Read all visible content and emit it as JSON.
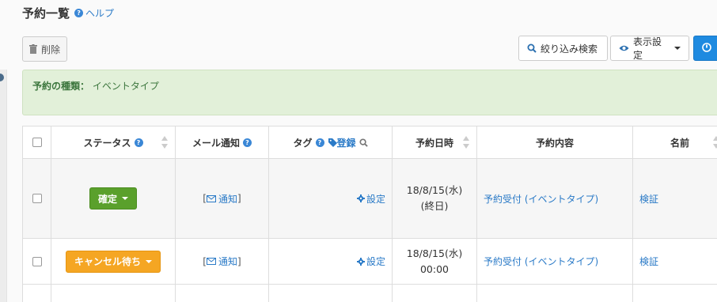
{
  "page": {
    "title": "予約一覧",
    "help_label": "ヘルプ",
    "help_icon_glyph": "?"
  },
  "toolbar": {
    "delete_label": "削除",
    "filter_label": "絞り込み検索",
    "display_label": "表示設定"
  },
  "info": {
    "label": "予約の種類：",
    "value": "イベントタイプ"
  },
  "table": {
    "headers": {
      "status": "ステータス",
      "mail": "メール通知",
      "tag": "タグ",
      "tag_register": "登録",
      "datetime": "予約日時",
      "content": "予約内容",
      "name": "名前"
    },
    "rows": [
      {
        "status": "確定",
        "status_color": "#5aa02c",
        "notify_open": "[",
        "notify_label": "通知",
        "notify_close": "]",
        "settings_label": "設定",
        "date_line1": "18/8/15(水)",
        "date_line2": "(終日)",
        "content": "予約受付 (イベントタイプ)",
        "name": "検証"
      },
      {
        "status": "キャンセル待ち",
        "status_color": "#f5a623",
        "notify_open": "[",
        "notify_label": "通知",
        "notify_close": "]",
        "settings_label": "設定",
        "date_line1": "18/8/15(水)",
        "date_line2": "00:00",
        "content": "予約受付 (イベントタイプ)",
        "name": "検証"
      }
    ]
  },
  "icons": {
    "help": "question-circle",
    "trash": "trash",
    "search": "magnifier",
    "eye": "eye",
    "power": "power",
    "tag": "tag",
    "mail": "envelope",
    "gear": "gear"
  },
  "colors": {
    "accent": "#2a7ac7",
    "info_bg": "#e2f0d9",
    "primary_btn": "#1e8ae0"
  }
}
